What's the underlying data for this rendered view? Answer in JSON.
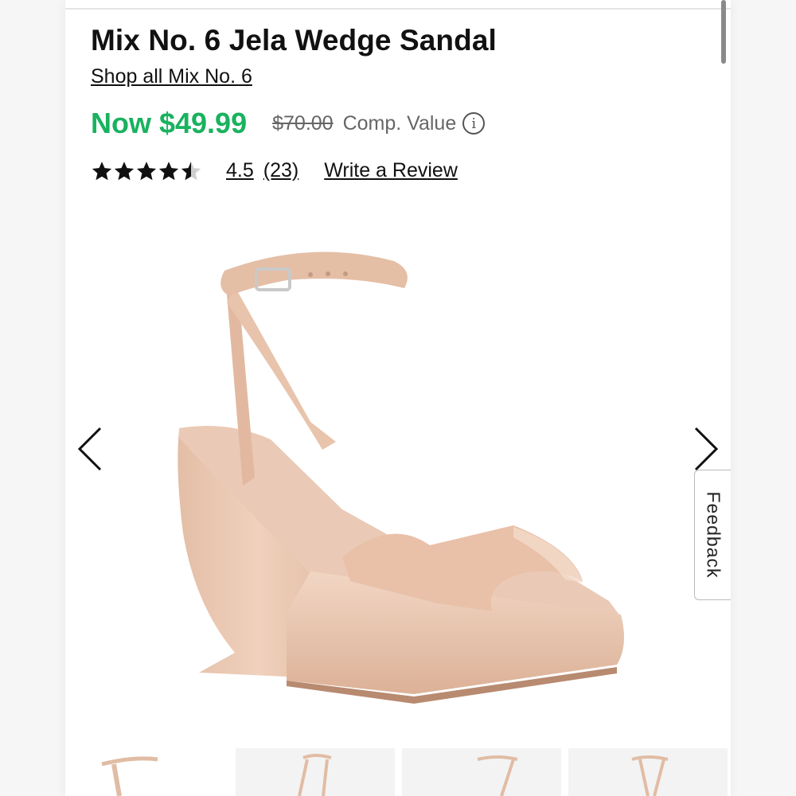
{
  "product": {
    "title": "Mix No. 6 Jela Wedge Sandal",
    "brand_link": "Shop all Mix No. 6"
  },
  "pricing": {
    "now_price": "Now $49.99",
    "comp_price": "$70.00",
    "comp_label": "Comp. Value",
    "info_icon": "info-circle-icon"
  },
  "rating": {
    "value": "4.5",
    "stars_filled": 4.5,
    "stars_total": 5,
    "review_count": "(23)",
    "write_review": "Write a Review"
  },
  "gallery": {
    "prev_icon": "chevron-left-icon",
    "next_icon": "chevron-right-icon",
    "thumbnail_count": 4,
    "active_thumbnail": 0
  },
  "feedback": {
    "label": "Feedback"
  },
  "colors": {
    "price_green": "#19b25f",
    "text_dark": "#111111",
    "text_muted": "#666666",
    "product_nude": "#e8c3ac"
  }
}
